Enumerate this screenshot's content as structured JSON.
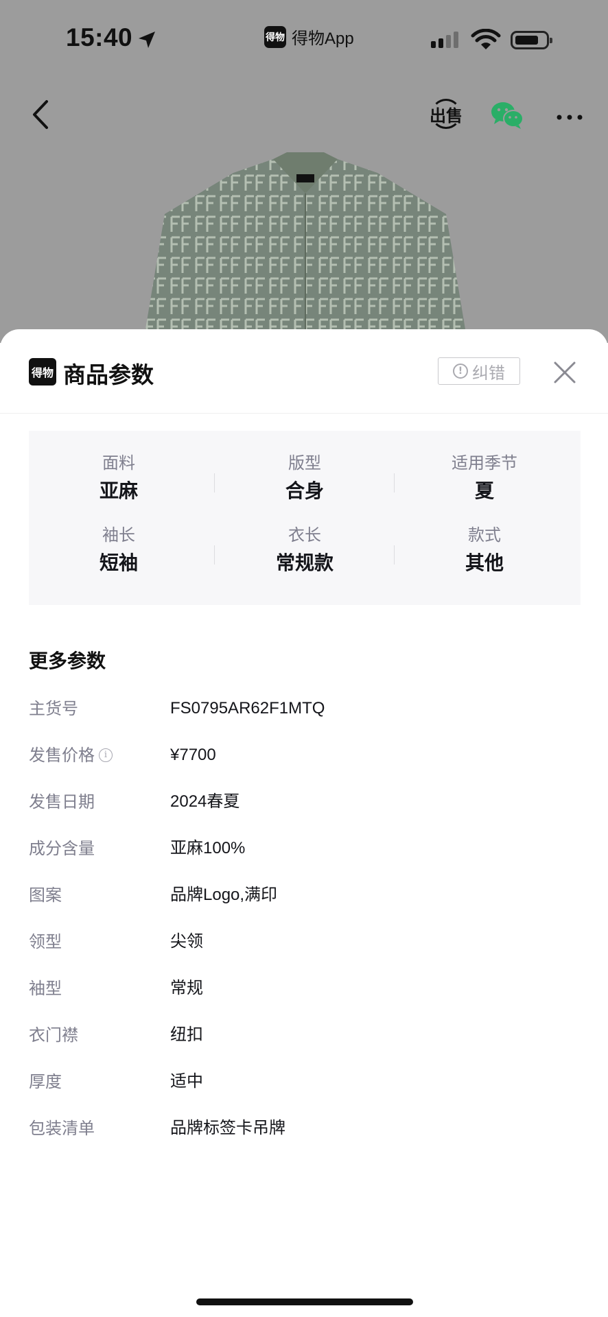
{
  "status_bar": {
    "time": "15:40",
    "source_app_label": "得物App",
    "source_app_logo_text": "得物",
    "icons": [
      "location-arrow-icon",
      "cellular-signal-icon",
      "wifi-icon",
      "battery-icon"
    ]
  },
  "nav": {
    "back_icon": "chevron-left-icon",
    "sell_label": "出售",
    "share_icon": "wechat-icon",
    "more_icon": "more-dots-icon"
  },
  "sheet": {
    "logo_text": "得物",
    "title": "商品参数",
    "report_label": "纠错",
    "report_icon": "alert-circle-icon",
    "close_icon": "close-icon",
    "key_specs": [
      {
        "label": "面料",
        "value": "亚麻"
      },
      {
        "label": "版型",
        "value": "合身"
      },
      {
        "label": "适用季节",
        "value": "夏"
      },
      {
        "label": "袖长",
        "value": "短袖"
      },
      {
        "label": "衣长",
        "value": "常规款"
      },
      {
        "label": "款式",
        "value": "其他"
      }
    ],
    "more_title": "更多参数",
    "params": [
      {
        "label": "主货号",
        "value": "FS0795AR62F1MTQ"
      },
      {
        "label": "发售价格",
        "value": "¥7700",
        "info_icon": "i"
      },
      {
        "label": "发售日期",
        "value": "2024春夏"
      },
      {
        "label": "成分含量",
        "value": "亚麻100%"
      },
      {
        "label": "图案",
        "value": "品牌Logo,满印"
      },
      {
        "label": "领型",
        "value": "尖领"
      },
      {
        "label": "袖型",
        "value": "常规"
      },
      {
        "label": "衣门襟",
        "value": "纽扣"
      },
      {
        "label": "厚度",
        "value": "适中"
      },
      {
        "label": "包装清单",
        "value": "品牌标签卡吊牌"
      }
    ]
  },
  "colors": {
    "dimmed_background": "#9c9c9c",
    "sheet_background": "#ffffff",
    "spec_panel": "#f7f7f9",
    "label_gray": "#7f7f8e",
    "text_dark": "#14151a",
    "wechat_green": "#2aae67",
    "shirt_green": "#6f7d6e"
  }
}
